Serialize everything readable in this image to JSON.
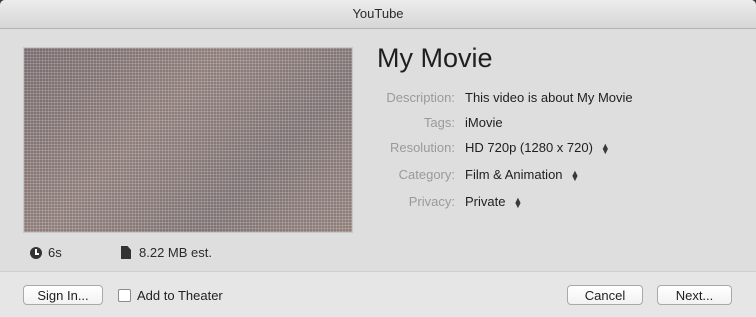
{
  "window": {
    "title": "YouTube"
  },
  "movie": {
    "title": "My Movie",
    "fields": [
      {
        "label": "Description:",
        "value": "This video is about My Movie",
        "stepper": false
      },
      {
        "label": "Tags:",
        "value": "iMovie",
        "stepper": false
      },
      {
        "label": "Resolution:",
        "value": "HD 720p (1280 x 720)",
        "stepper": true
      },
      {
        "label": "Category:",
        "value": "Film & Animation",
        "stepper": true
      },
      {
        "label": "Privacy:",
        "value": "Private",
        "stepper": true
      }
    ],
    "duration": "6s",
    "size": "8.22 MB est."
  },
  "footer": {
    "sign_in_label": "Sign In...",
    "add_to_theater_label": "Add to Theater",
    "add_to_theater_checked": false,
    "cancel_label": "Cancel",
    "next_label": "Next..."
  },
  "icons": {
    "duration": "clock-icon",
    "size": "file-icon",
    "stepper": "up-down-arrows-icon"
  }
}
